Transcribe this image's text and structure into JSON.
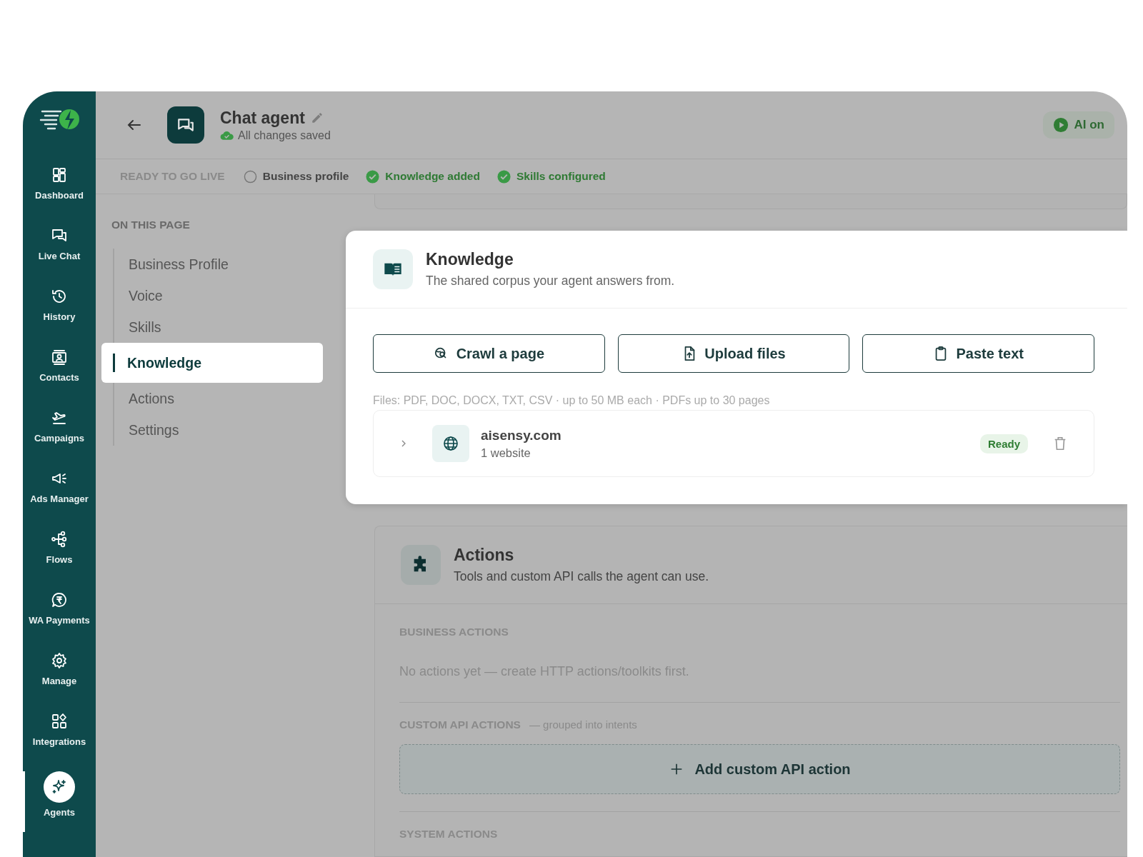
{
  "sidebar": {
    "items": [
      {
        "label": "Dashboard",
        "selected": false
      },
      {
        "label": "Live Chat",
        "selected": false
      },
      {
        "label": "History",
        "selected": false
      },
      {
        "label": "Contacts",
        "selected": false
      },
      {
        "label": "Campaigns",
        "selected": false
      },
      {
        "label": "Ads Manager",
        "selected": false
      },
      {
        "label": "Flows",
        "selected": false
      },
      {
        "label": "WA Payments",
        "selected": false
      },
      {
        "label": "Manage",
        "selected": false
      },
      {
        "label": "Integrations",
        "selected": false
      },
      {
        "label": "Agents",
        "selected": true
      }
    ]
  },
  "header": {
    "title": "Chat agent",
    "save_status": "All changes saved",
    "ai_toggle": {
      "label": "AI on",
      "on": true
    }
  },
  "checklist": {
    "label": "READY TO GO LIVE",
    "items": [
      {
        "label": "Business profile",
        "done": false
      },
      {
        "label": "Knowledge added",
        "done": true
      },
      {
        "label": "Skills configured",
        "done": true
      }
    ]
  },
  "on_this_page": {
    "heading": "ON THIS PAGE",
    "items": [
      {
        "label": "Business Profile",
        "selected": false
      },
      {
        "label": "Voice",
        "selected": false
      },
      {
        "label": "Skills",
        "selected": false
      },
      {
        "label": "Knowledge",
        "selected": true
      },
      {
        "label": "Actions",
        "selected": false
      },
      {
        "label": "Settings",
        "selected": false
      }
    ]
  },
  "knowledge": {
    "title": "Knowledge",
    "subtitle": "The shared corpus your agent answers from.",
    "buttons": [
      "Crawl a page",
      "Upload files",
      "Paste text"
    ],
    "hint": "Files: PDF, DOC, DOCX, TXT, CSV · up to 50 MB each · PDFs up to 30 pages",
    "sources": [
      {
        "name": "aisensy.com",
        "detail": "1 website",
        "status": "Ready"
      }
    ]
  },
  "actions": {
    "title": "Actions",
    "subtitle": "Tools and custom API calls the agent can use.",
    "business_heading": "BUSINESS ACTIONS",
    "business_empty": "No actions yet — create HTTP actions/toolkits first.",
    "custom_heading": "CUSTOM API ACTIONS",
    "custom_note": "— grouped into intents",
    "add_button": "Add custom API action",
    "system_heading": "SYSTEM ACTIONS"
  }
}
